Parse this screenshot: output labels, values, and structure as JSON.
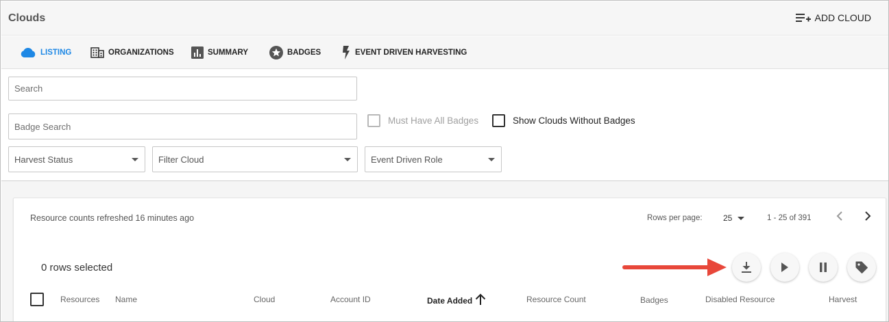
{
  "header": {
    "title": "Clouds",
    "add_cloud_label": "ADD CLOUD"
  },
  "tabs": [
    {
      "label": "LISTING",
      "icon": "cloud-icon",
      "active": true
    },
    {
      "label": "ORGANIZATIONS",
      "icon": "building-icon",
      "active": false
    },
    {
      "label": "SUMMARY",
      "icon": "bar-chart-icon",
      "active": false
    },
    {
      "label": "BADGES",
      "icon": "star-badge-icon",
      "active": false
    },
    {
      "label": "EVENT DRIVEN HARVESTING",
      "icon": "lightning-icon",
      "active": false
    }
  ],
  "filters": {
    "search_placeholder": "Search",
    "badge_search_placeholder": "Badge Search",
    "must_have_all_badges": "Must Have All Badges",
    "show_without_badges": "Show Clouds Without Badges",
    "harvest_status": "Harvest Status",
    "filter_cloud": "Filter Cloud",
    "event_driven_role": "Event Driven Role"
  },
  "table_panel": {
    "refresh_status": "Resource counts refreshed 16 minutes ago",
    "rows_per_page_label": "Rows per page:",
    "rows_per_page_value": "25",
    "range_text": "1 - 25 of 391",
    "rows_selected": "0 rows selected",
    "actions": [
      "download-icon",
      "play-icon",
      "pause-icon",
      "tag-icon"
    ],
    "columns": [
      "Resources",
      "Name",
      "Cloud",
      "Account ID",
      "Date Added",
      "Resource Count",
      "Badges",
      "Disabled Resource",
      "Harvest"
    ],
    "sorted_column": "Date Added",
    "sort_direction": "ascending"
  },
  "colors": {
    "accent": "#1e88e5",
    "annotation_arrow": "#e8473a"
  }
}
